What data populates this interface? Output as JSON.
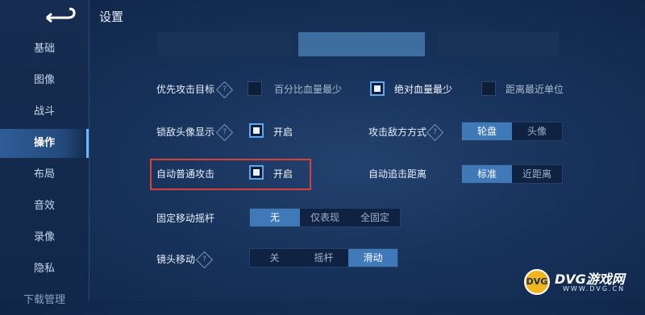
{
  "header": {
    "title": "设置"
  },
  "sidebar": {
    "items": [
      {
        "label": "基础"
      },
      {
        "label": "图像"
      },
      {
        "label": "战斗"
      },
      {
        "label": "操作"
      },
      {
        "label": "布局"
      },
      {
        "label": "音效"
      },
      {
        "label": "录像"
      },
      {
        "label": "隐私"
      },
      {
        "label": "下载管理"
      }
    ],
    "active": "操作"
  },
  "settings": {
    "attack_target": {
      "label": "优先攻击目标",
      "options": [
        {
          "label": "百分比血量最少",
          "checked": false
        },
        {
          "label": "绝对血量最少",
          "checked": true
        },
        {
          "label": "距离最近单位",
          "checked": false
        }
      ]
    },
    "lock_avatar": {
      "label": "锁敌头像显示",
      "option": "开启",
      "checked": true
    },
    "attack_enemy_mode": {
      "label": "攻击敌方方式",
      "options": [
        "轮盘",
        "头像"
      ],
      "selected": "轮盘"
    },
    "auto_attack": {
      "label": "自动普通攻击",
      "option": "开启",
      "checked": true
    },
    "auto_chase": {
      "label": "自动追击距离",
      "options": [
        "标准",
        "近距离"
      ],
      "selected": "标准"
    },
    "fixed_joystick": {
      "label": "固定移动摇杆",
      "options": [
        "无",
        "仅表现",
        "全固定"
      ],
      "selected": "无"
    },
    "camera_move": {
      "label": "镜头移动",
      "options": [
        "关",
        "摇杆",
        "滑动"
      ],
      "selected": "滑动"
    }
  },
  "watermark": {
    "title": "DVG游戏网",
    "url": "WWW.DVG.CN",
    "badge": "DVG"
  },
  "colors": {
    "accent": "#3f79b8",
    "highlight_border": "#d8403a"
  }
}
